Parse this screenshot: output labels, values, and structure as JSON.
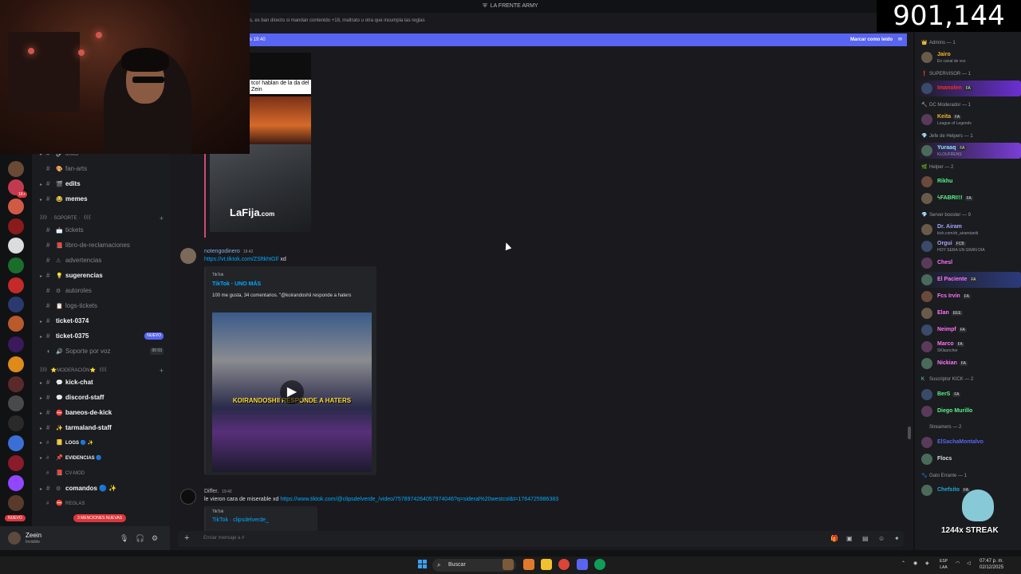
{
  "titlebar": {
    "server_name": "LA FRENTE ARMY"
  },
  "stream_overlay": {
    "viewer_count": "901,144",
    "streak_label": "1244x STREAK"
  },
  "chat": {
    "topic": "s, es ban directo si mandan contenido +18, maltrato u otra que incumpla las reglas",
    "unread_bar": {
      "left": "s 19:40",
      "mark_read": "Marcar como leído"
    },
    "thumbnail_caption": "tco! hablan de la da del Zein",
    "thumbnail_logo": "LaFija",
    "thumbnail_logo_suffix": ".com",
    "messages": [
      {
        "author": "notengodinero",
        "time": "19:42",
        "link": "https://vt.tiktok.com/ZSftkhtGf/",
        "text": "xd",
        "embed": {
          "provider": "TikTok",
          "title": "TikTok · UNO MÁS",
          "description": "100 me gusta, 34 comentarios. \"@koirandoshii responde a haters",
          "video_overlay": "KOIRANDOSHII RESPONDE A HATERS"
        }
      },
      {
        "author": "Differ.",
        "time": "19:42",
        "text": "le vieron cara de miserable xd",
        "link": "https://www.tiktok.com/@clipsdelverde_/video/757897426405797404​6?q=sideral%20westcol&t=1764725986383",
        "embed": {
          "provider": "TikTok",
          "title": "TikTok · clipsdelverde_"
        }
      }
    ],
    "composer_placeholder": "Enviar mensaje a #"
  },
  "sidebar": {
    "channels": [
      {
        "name": "links",
        "emoji": "🔗",
        "bold": false
      },
      {
        "name": "fan-arts",
        "emoji": "🎨",
        "bold": false
      },
      {
        "name": "edits",
        "emoji": "🎬",
        "bold": true
      },
      {
        "name": "memes",
        "emoji": "😂",
        "bold": true
      }
    ],
    "category_support": "》》》 · SOPORTE · 《《《",
    "support_channels": [
      {
        "name": "tickets",
        "emoji": "📩",
        "bold": false
      },
      {
        "name": "libro-de-reclamaciones",
        "emoji": "📕",
        "bold": false
      },
      {
        "name": "advertencias",
        "emoji": "⚠",
        "bold": false
      },
      {
        "name": "sugerencias",
        "emoji": "💡",
        "bold": true
      },
      {
        "name": "autoroles",
        "emoji": "⚙",
        "bold": false
      },
      {
        "name": "logs-tickets",
        "emoji": "📋",
        "bold": false
      },
      {
        "name": "ticket-0374",
        "emoji": "",
        "bold": true
      },
      {
        "name": "ticket-0375",
        "emoji": "",
        "bold": true,
        "badge": "NUEVO"
      },
      {
        "name": "Soporte por voz",
        "emoji": "🔊",
        "bold": false,
        "voice": "00 03"
      }
    ],
    "category_mod": "》》》 ⭐MODERACIÓN⭐ 《《《",
    "mod_channels": [
      {
        "name": "kick-chat",
        "emoji": "💬",
        "bold": true
      },
      {
        "name": "discord-staff",
        "emoji": "💬",
        "bold": true
      },
      {
        "name": "baneos-de-kick",
        "emoji": "⛔",
        "bold": true
      },
      {
        "name": "tarmaland-staff",
        "emoji": "✨",
        "bold": true
      },
      {
        "name": "LOGS 🔵 ✨",
        "emoji": "📒",
        "bold": true
      },
      {
        "name": "EVIDENCIAS 🔵",
        "emoji": "📌",
        "bold": true
      },
      {
        "name": "CV-MOD",
        "emoji": "📕",
        "bold": false
      },
      {
        "name": "comandos 🔵 ✨",
        "emoji": "⚙",
        "bold": true
      },
      {
        "name": "REGLAS",
        "emoji": "⛔",
        "bold": false
      }
    ],
    "mentions_pill": "3 MENCIONES NUEVAS",
    "nuevo_tag": "NUEVO"
  },
  "user_panel": {
    "name": "Zeein",
    "status": "Invisible"
  },
  "members": {
    "groups": [
      {
        "role": "Admins — 1",
        "color": "#f0b232",
        "icon": "👑",
        "members": [
          {
            "name": "Jairo",
            "status": "En canal de voz",
            "color": "#f0b232"
          }
        ]
      },
      {
        "role": "SUPERVISOR — 1",
        "color": "#da373c",
        "icon": "❗",
        "members": [
          {
            "name": "Imanolen",
            "tag": "FA",
            "color": "#ff2b2b",
            "highlight": "#6b2fd1"
          }
        ]
      },
      {
        "role": "DC Moderador — 1",
        "color": "#f0b232",
        "icon": "🔨",
        "members": [
          {
            "name": "Keita",
            "tag": "FA",
            "status": "League of Legends",
            "color": "#f0b232"
          }
        ]
      },
      {
        "role": "Jefe de Helpers — 1",
        "color": "#23a5d5",
        "icon": "💎",
        "members": [
          {
            "name": "Yuraaq",
            "tag": "FA",
            "status": "KLOUFRENS",
            "color": "#7ee8ff",
            "highlight": "#7a3dd6"
          }
        ]
      },
      {
        "role": "Helper — 2",
        "color": "#57f287",
        "icon": "🌿",
        "members": [
          {
            "name": "Rikhu",
            "color": "#57f287"
          },
          {
            "name": "ϟFABRI!!!",
            "tag": "FA",
            "color": "#57f287"
          }
        ]
      },
      {
        "role": "Server booster — 9",
        "color": "#ff73fa",
        "icon": "💎",
        "members": [
          {
            "name": "Dr. Airam",
            "status": "kick.com/dr_airamtaniti",
            "color": "#a5a5ff"
          },
          {
            "name": "Orgui",
            "tag": "FCB",
            "status": "HOY SERA UN GRAN DIA",
            "color": "#a5a5ff"
          },
          {
            "name": "Chesl",
            "color": "#ff73fa"
          },
          {
            "name": "El Paciente",
            "tag": "FA",
            "color": "#ff73fa",
            "highlight": "#2d3a7a"
          },
          {
            "name": "Fcs Irvin",
            "tag": "FA",
            "color": "#ff73fa"
          },
          {
            "name": "Elan",
            "tag": "EEE",
            "color": "#ff73fa"
          },
          {
            "name": "Neimpf",
            "tag": "FA",
            "color": "#ff73fa"
          },
          {
            "name": "Marco",
            "tag": "FA",
            "status": "SKlauncher",
            "color": "#ff73fa"
          },
          {
            "name": "Nickian",
            "tag": "FA",
            "color": "#ff73fa"
          }
        ]
      },
      {
        "role": "Suscriptor KICK — 2",
        "color": "#57f287",
        "icon": "K",
        "members": [
          {
            "name": "BerS",
            "tag": "FA",
            "color": "#57f287"
          },
          {
            "name": "Diego Murillo",
            "color": "#57f287"
          }
        ]
      },
      {
        "role": "Streamers — 2",
        "color": "#949ba4",
        "icon": "",
        "members": [
          {
            "name": "ElSachaMontalvo",
            "color": "#5865f2"
          },
          {
            "name": "Flocs",
            "color": "#dbdee1"
          }
        ]
      },
      {
        "role": "Gato Errante — 1",
        "color": "#949ba4",
        "icon": "🐾",
        "members": [
          {
            "name": "Chefsito",
            "tag": "FA",
            "color": "#23a5d5"
          }
        ]
      }
    ]
  },
  "taskbar": {
    "search_label": "Buscar",
    "lang": "ESP",
    "lang2": "LAA",
    "time": "07:47 p. m.",
    "date": "02/12/2025"
  }
}
